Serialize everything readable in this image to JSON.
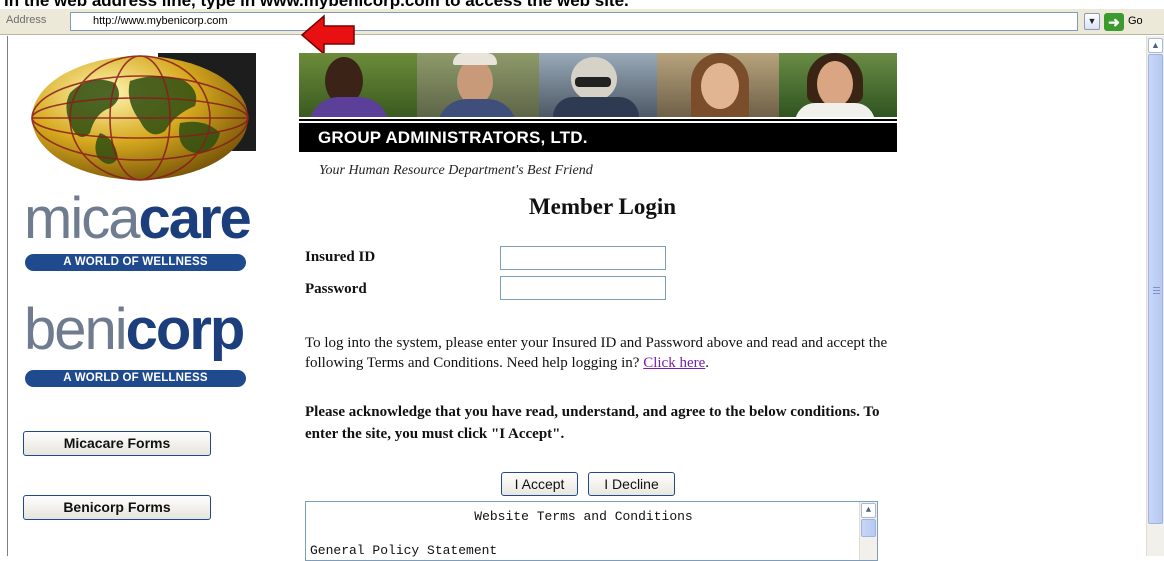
{
  "instruction": "In the web address line, type in www.mybenicorp.com to access the web site.",
  "browser": {
    "address_label": "Address",
    "url": "http://www.mybenicorp.com",
    "go_label": "Go"
  },
  "sidebar": {
    "brand1_light": "mica",
    "brand1_bold": "care",
    "brand1_tagline": "A WORLD OF WELLNESS",
    "brand2_light": "beni",
    "brand2_bold": "corp",
    "brand2_tagline": "A WORLD OF WELLNESS",
    "buttons": [
      {
        "label": "Micacare Forms"
      },
      {
        "label": "Benicorp Forms"
      }
    ]
  },
  "banner": {
    "title": "GROUP ADMINISTRATORS, LTD.",
    "tagline": "Your Human Resource Department's Best Friend"
  },
  "login": {
    "title": "Member Login",
    "insured_id_label": "Insured ID",
    "insured_id_value": "",
    "password_label": "Password",
    "password_value": "",
    "instructions": "To log into the system, please enter your Insured ID and Password above and read and accept the following Terms and Conditions. Need help logging in?",
    "help_link": "Click here",
    "acknowledge": "Please acknowledge that you have read, understand, and agree to the below conditions. To enter the site, you must click \"I Accept\".",
    "accept_label": "I Accept",
    "decline_label": "I Decline"
  },
  "terms": {
    "title": "Website Terms and Conditions",
    "first_section": "General Policy Statement"
  },
  "colors": {
    "brand_blue": "#1f4a8e",
    "brand_grey": "#6f7b8f",
    "link_purple": "#7a1fa8",
    "pointer_red": "#e81010"
  }
}
